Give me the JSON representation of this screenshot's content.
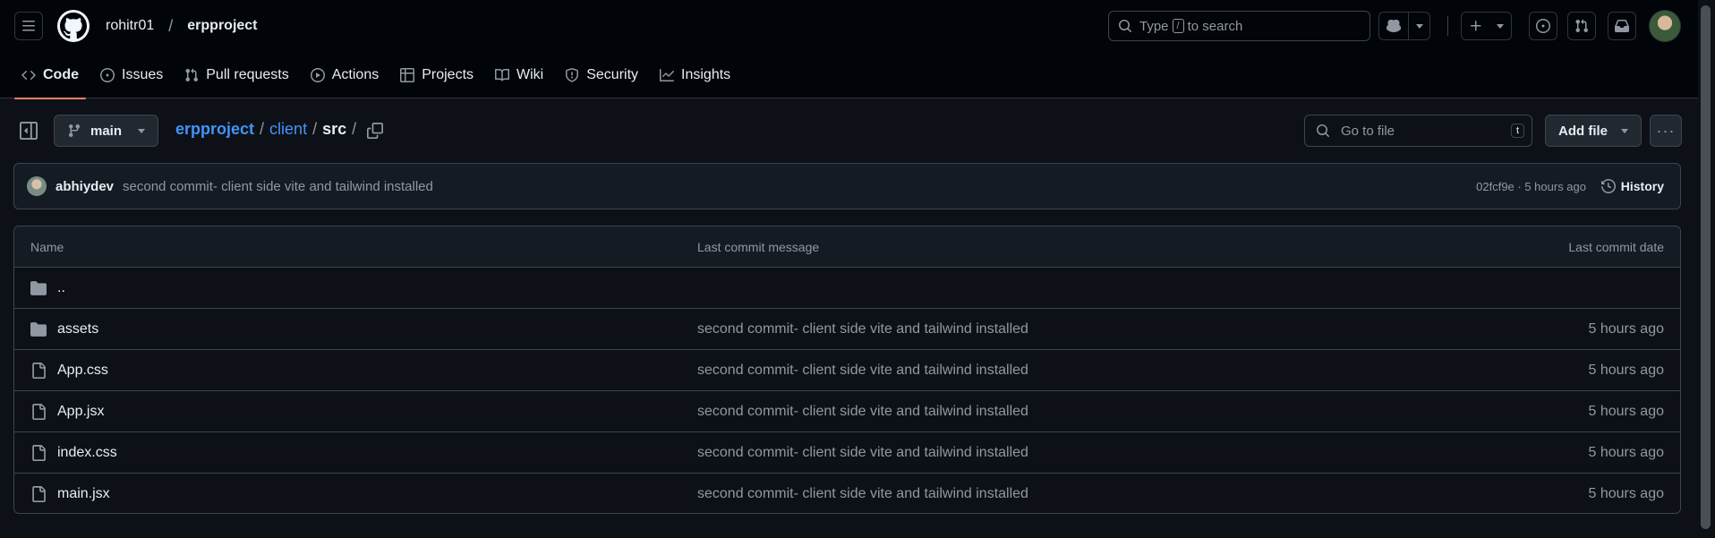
{
  "header": {
    "owner": "rohitr01",
    "separator": "/",
    "repo": "erpproject",
    "search_text_before": "Type",
    "search_key": "/",
    "search_text_after": "to search"
  },
  "tabs": [
    {
      "label": "Code",
      "icon": "code-icon"
    },
    {
      "label": "Issues",
      "icon": "issue-opened-icon"
    },
    {
      "label": "Pull requests",
      "icon": "git-pull-request-icon"
    },
    {
      "label": "Actions",
      "icon": "play-icon"
    },
    {
      "label": "Projects",
      "icon": "table-icon"
    },
    {
      "label": "Wiki",
      "icon": "book-icon"
    },
    {
      "label": "Security",
      "icon": "shield-icon"
    },
    {
      "label": "Insights",
      "icon": "graph-icon"
    }
  ],
  "toolbar": {
    "branch": "main",
    "path": [
      "erpproject",
      "client",
      "src"
    ],
    "go_to_file_placeholder": "Go to file",
    "go_to_file_key": "t",
    "add_file_label": "Add file",
    "more_label": "···"
  },
  "commit": {
    "author": "abhiydev",
    "message": "second commit- client side vite and tailwind installed",
    "meta": "02fcf9e · 5 hours ago",
    "history_label": "History"
  },
  "table": {
    "headers": {
      "name": "Name",
      "message": "Last commit message",
      "date": "Last commit date"
    },
    "rows": [
      {
        "name": "..",
        "type": "folder",
        "message": "",
        "date": ""
      },
      {
        "name": "assets",
        "type": "folder",
        "message": "second commit- client side vite and tailwind installed",
        "date": "5 hours ago"
      },
      {
        "name": "App.css",
        "type": "file",
        "message": "second commit- client side vite and tailwind installed",
        "date": "5 hours ago"
      },
      {
        "name": "App.jsx",
        "type": "file",
        "message": "second commit- client side vite and tailwind installed",
        "date": "5 hours ago"
      },
      {
        "name": "index.css",
        "type": "file",
        "message": "second commit- client side vite and tailwind installed",
        "date": "5 hours ago"
      },
      {
        "name": "main.jsx",
        "type": "file",
        "message": "second commit- client side vite and tailwind installed",
        "date": "5 hours ago"
      }
    ]
  },
  "colors": {
    "background": "#0d1117",
    "header_bg": "#010409",
    "link": "#4493f8",
    "tab_underline": "#f78166",
    "folder_icon": "#9198a1"
  }
}
